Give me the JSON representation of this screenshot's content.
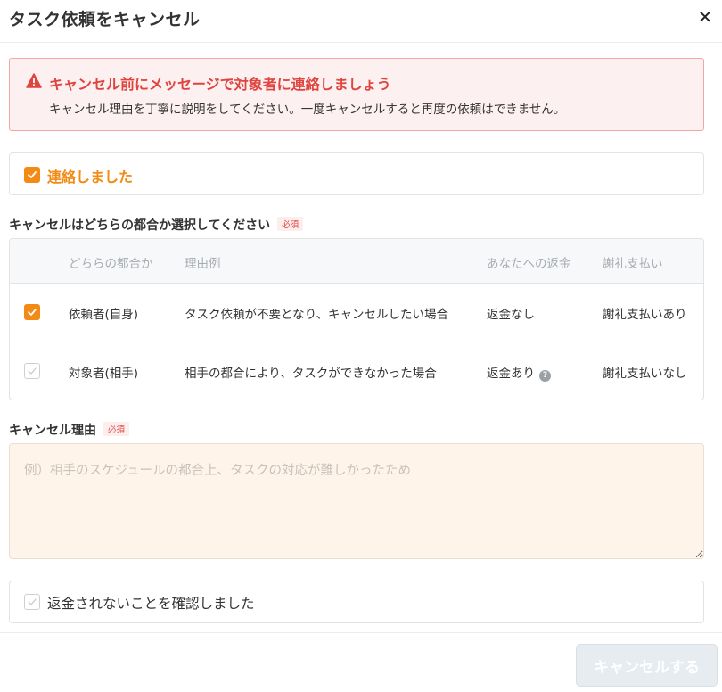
{
  "header": {
    "title": "タスク依頼をキャンセル",
    "close_label": "✕"
  },
  "alert": {
    "title": "キャンセル前にメッセージで対象者に連絡しましょう",
    "body": "キャンセル理由を丁寧に説明をしてください。一度キャンセルすると再度の依頼はできません。"
  },
  "contacted": {
    "label": "連絡しました",
    "checked": true
  },
  "who_section": {
    "label": "キャンセルはどちらの都合か選択してください",
    "required": "必須"
  },
  "table": {
    "headers": [
      "どちらの都合か",
      "理由例",
      "あなたへの返金",
      "謝礼支払い"
    ],
    "rows": [
      {
        "checked": true,
        "party": "依頼者(自身)",
        "example": "タスク依頼が不要となり、キャンセルしたい場合",
        "refund": "返金なし",
        "payment": "謝礼支払いあり"
      },
      {
        "checked": false,
        "party": "対象者(相手)",
        "example": "相手の都合により、タスクができなかった場合",
        "refund": "返金あり",
        "payment": "謝礼支払いなし"
      }
    ],
    "help_icon": "?"
  },
  "reason_section": {
    "label": "キャンセル理由",
    "required": "必須",
    "placeholder": "例）相手のスケジュールの都合上、タスクの対応が難しかったため",
    "value": ""
  },
  "confirm": {
    "label": "返金されないことを確認しました",
    "checked": false
  },
  "footer": {
    "submit_label": "キャンセルする"
  },
  "colors": {
    "accent": "#f28a14",
    "danger": "#e0443f",
    "alert_bg": "#fdf0f0",
    "textarea_bg": "#fef4ea",
    "disabled_button": "#e6ecf0"
  },
  "icons": {
    "alert": "warning-triangle-icon",
    "close": "close-icon",
    "check": "checkmark-icon",
    "help": "question-circle-icon"
  }
}
